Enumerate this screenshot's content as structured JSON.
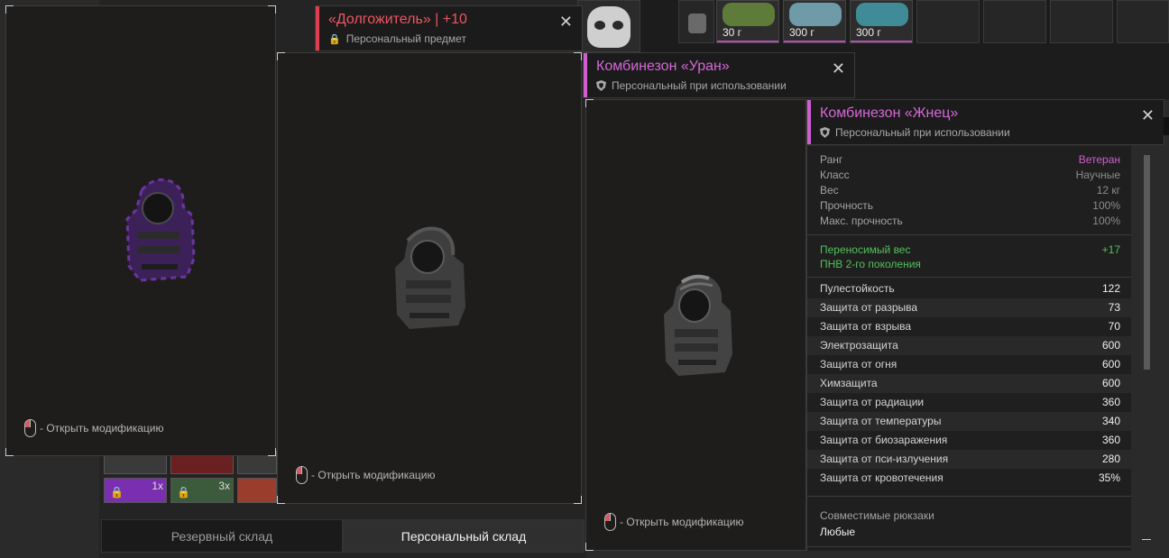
{
  "inventory": {
    "slots": [
      {
        "weight": "30 г",
        "color": "#5f7b3a"
      },
      {
        "weight": "300 г",
        "color": "#6f9aa8"
      },
      {
        "weight": "300 г",
        "color": "#3f8c98"
      }
    ],
    "mini_items": [
      {
        "count": "1x",
        "color": "#7a2fb0"
      },
      {
        "count": "3x",
        "color": "#3c5a3c"
      },
      {
        "count": "",
        "color": "#9b3d2c"
      }
    ]
  },
  "tabs": {
    "reserve": "Резервный склад",
    "personal": "Персональный склад"
  },
  "hint": {
    "open_mod": "- Открыть модификацию"
  },
  "card1": {
    "title": "«Долгожитель» | +10",
    "subtitle": "Персональный предмет",
    "accent": "#e0404e",
    "suit_color": "#5b2a86"
  },
  "card2": {
    "title": "Комбинезон «Уран»",
    "subtitle": "Персональный при использовании",
    "accent": "#cf5dcf"
  },
  "card3": {
    "title": "Комбинезон «Жнец»",
    "subtitle": "Персональный при использовании",
    "accent": "#cf5dcf",
    "info": [
      {
        "label": "Ранг",
        "value": "Ветеран"
      },
      {
        "label": "Класс",
        "value": "Научные"
      },
      {
        "label": "Вес",
        "value": "12 кг"
      },
      {
        "label": "Прочность",
        "value": "100%"
      },
      {
        "label": "Макс. прочность",
        "value": "100%"
      }
    ],
    "bonuses": [
      {
        "label": "Переносимый вес",
        "value": "+17"
      },
      {
        "label": "ПНВ 2-го поколения",
        "value": ""
      }
    ],
    "protection": [
      {
        "label": "Пулестойкость",
        "value": "122"
      },
      {
        "label": "Защита от разрыва",
        "value": "73"
      },
      {
        "label": "Защита от взрыва",
        "value": "70"
      },
      {
        "label": "Электрозащита",
        "value": "600"
      },
      {
        "label": "Защита от огня",
        "value": "600"
      },
      {
        "label": "Химзащита",
        "value": "600"
      },
      {
        "label": "Защита от радиации",
        "value": "360"
      },
      {
        "label": "Защита от температуры",
        "value": "340"
      },
      {
        "label": "Защита от биозаражения",
        "value": "360"
      },
      {
        "label": "Защита от пси-излучения",
        "value": "280"
      },
      {
        "label": "Защита от кровотечения",
        "value": "35%"
      }
    ],
    "backpacks_label": "Совместимые рюкзаки",
    "backpacks_value": "Любые",
    "rank_color": "#cf5dcf"
  }
}
